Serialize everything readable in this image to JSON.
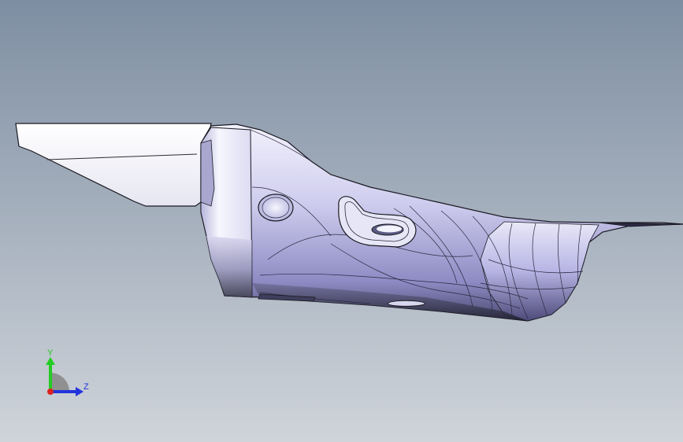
{
  "viewport": {
    "colors": {
      "background_top": "#7e8ea2",
      "background_bottom": "#cfd4da",
      "part_light": "#f4f4fc",
      "part_mid": "#c9c7ea",
      "part_dark": "#3a3a55",
      "edge": "#1a1a22"
    }
  },
  "triad": {
    "y_label": "Y",
    "z_label": "Z",
    "colors": {
      "y_axis": "#22cc22",
      "z_axis": "#2233dd",
      "x_axis": "#dd2222",
      "plane": "#8a8a8a"
    }
  }
}
